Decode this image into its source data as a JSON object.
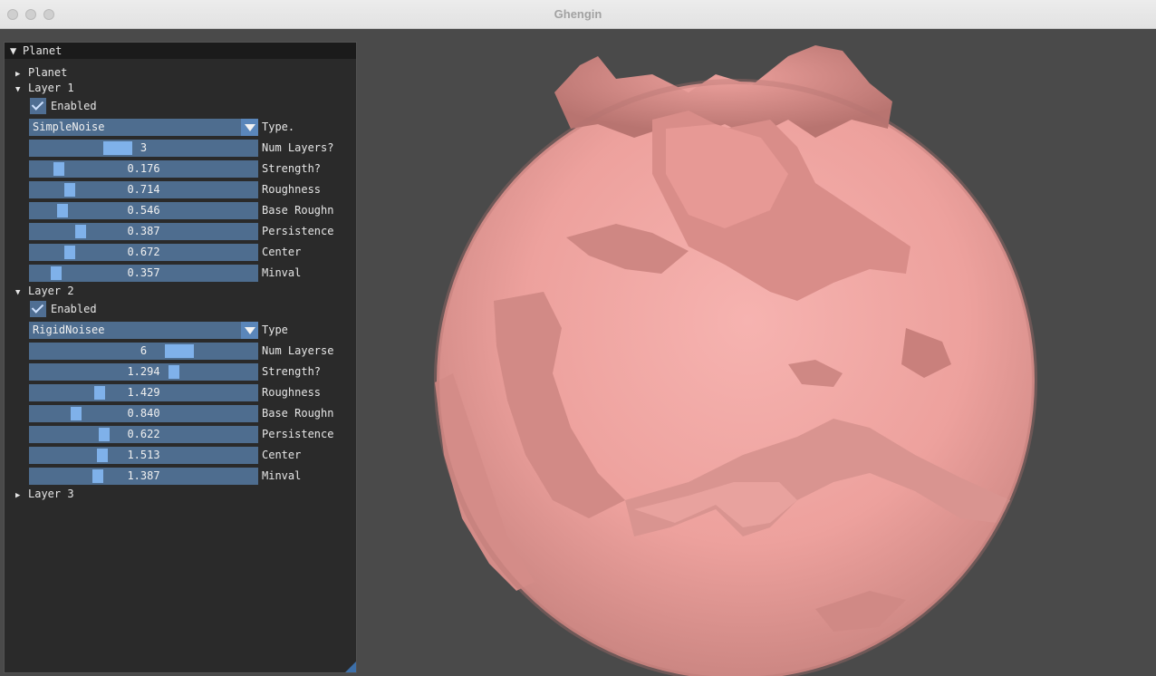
{
  "window": {
    "title": "Ghengin"
  },
  "panel": {
    "title": "Planet",
    "items": {
      "planet_node": "Planet",
      "layer1": {
        "label": "Layer 1",
        "enabled_label": "Enabled",
        "enabled": true,
        "type_value": "SimpleNoise",
        "type_label": "Type.",
        "sliders": [
          {
            "label": "Num Layers?",
            "value": "3",
            "fill": 0.37
          },
          {
            "label": "Strength?",
            "value": "0.176",
            "fill": 0.11
          },
          {
            "label": "Roughness",
            "value": "0.714",
            "fill": 0.16
          },
          {
            "label": "Base Roughn",
            "value": "0.546",
            "fill": 0.13
          },
          {
            "label": "Persistence",
            "value": "0.387",
            "fill": 0.21
          },
          {
            "label": "Center",
            "value": "0.672",
            "fill": 0.16
          },
          {
            "label": "Minval",
            "value": "0.357",
            "fill": 0.1
          }
        ]
      },
      "layer2": {
        "label": "Layer 2",
        "enabled_label": "Enabled",
        "enabled": true,
        "type_value": "RigidNoisee",
        "type_label": "Type",
        "sliders": [
          {
            "label": "Num Layerse",
            "value": "6",
            "fill": 0.68
          },
          {
            "label": "Strength?",
            "value": "1.294",
            "fill": 0.64
          },
          {
            "label": "Roughness",
            "value": "1.429",
            "fill": 0.3
          },
          {
            "label": "Base Roughn",
            "value": "0.840",
            "fill": 0.19
          },
          {
            "label": "Persistence",
            "value": "0.622",
            "fill": 0.32
          },
          {
            "label": "Center",
            "value": "1.513",
            "fill": 0.31
          },
          {
            "label": "Minval",
            "value": "1.387",
            "fill": 0.29
          }
        ]
      },
      "layer3": {
        "label": "Layer 3"
      }
    }
  },
  "viewport": {
    "planet_color": "#f2a5a2",
    "background": "#4a4a4a"
  }
}
